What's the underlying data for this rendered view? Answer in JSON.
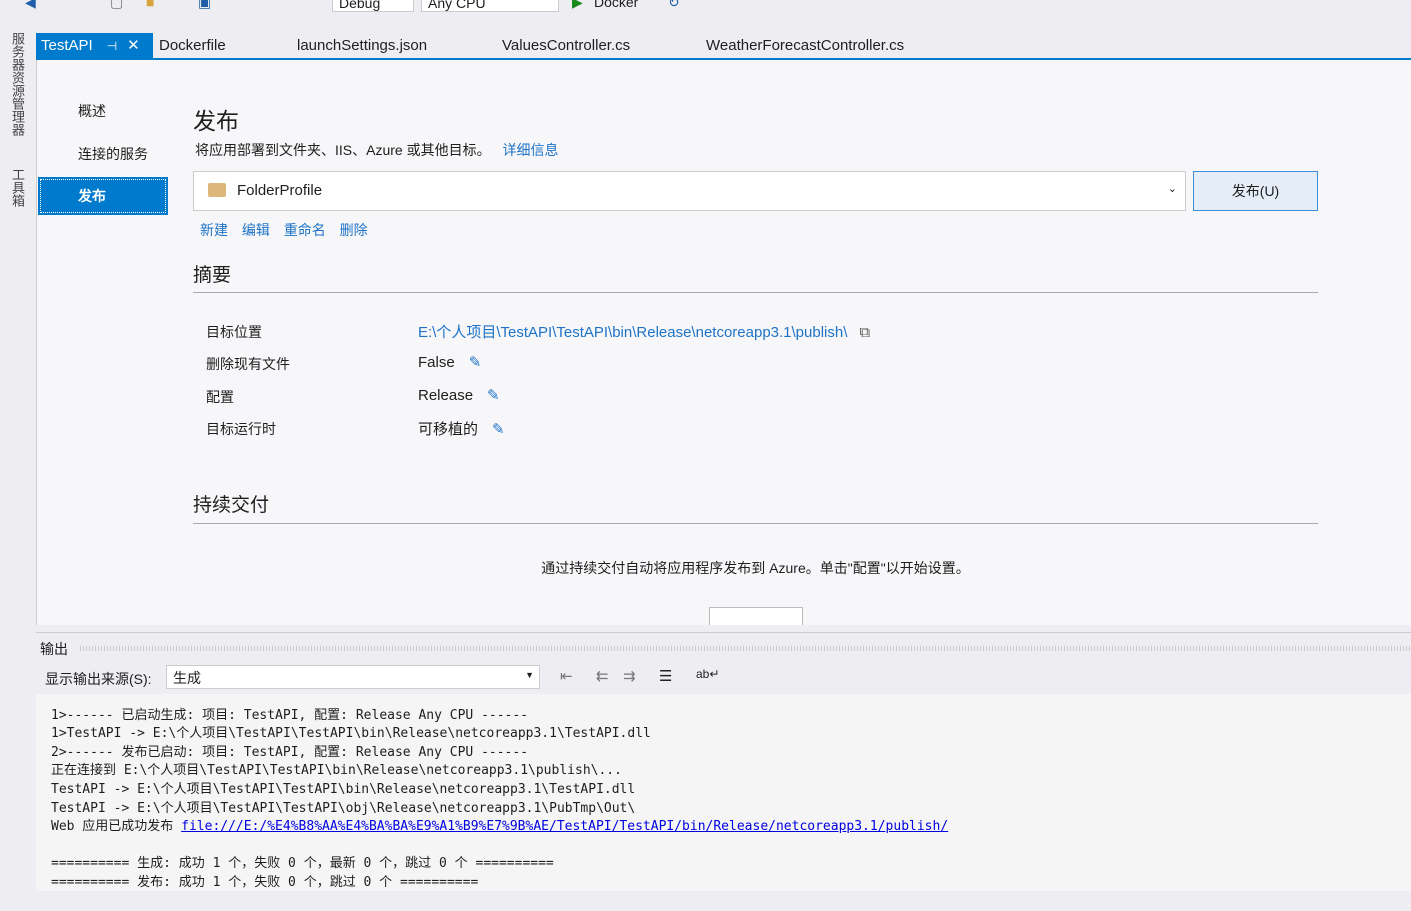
{
  "toolbar": {
    "config": "Debug",
    "platform": "Any CPU",
    "run_target": "Docker"
  },
  "left_strip": {
    "server_explorer": "服务器资源管理器",
    "toolbox": "工具箱"
  },
  "tabs": [
    {
      "label": "TestAPI"
    },
    {
      "label": "Dockerfile"
    },
    {
      "label": "launchSettings.json"
    },
    {
      "label": "ValuesController.cs"
    },
    {
      "label": "WeatherForecastController.cs"
    }
  ],
  "nav": [
    "概述",
    "连接的服务",
    "发布"
  ],
  "publish": {
    "title": "发布",
    "desc": "将应用部署到文件夹、IIS、Azure 或其他目标。",
    "more": "详细信息",
    "profile": "FolderProfile",
    "publish_btn": "发布(U)",
    "actions": [
      "新建",
      "编辑",
      "重命名",
      "删除"
    ]
  },
  "summary": {
    "title": "摘要",
    "rows": [
      {
        "label": "目标位置",
        "value": "E:\\个人项目\\TestAPI\\TestAPI\\bin\\Release\\netcoreapp3.1\\publish\\"
      },
      {
        "label": "删除现有文件",
        "value": "False"
      },
      {
        "label": "配置",
        "value": "Release"
      },
      {
        "label": "目标运行时",
        "value": "可移植的"
      }
    ]
  },
  "cd": {
    "title": "持续交付",
    "text": "通过持续交付自动将应用程序发布到 Azure。单击\"配置\"以开始设置。"
  },
  "output": {
    "title": "输出",
    "source_label": "显示输出来源(S):",
    "source": "生成",
    "lines": [
      "1>------ 已启动生成: 项目: TestAPI, 配置: Release Any CPU ------",
      "1>TestAPI -> E:\\个人项目\\TestAPI\\TestAPI\\bin\\Release\\netcoreapp3.1\\TestAPI.dll",
      "2>------ 发布已启动: 项目: TestAPI, 配置: Release Any CPU ------",
      "正在连接到 E:\\个人项目\\TestAPI\\TestAPI\\bin\\Release\\netcoreapp3.1\\publish\\...",
      "TestAPI -> E:\\个人项目\\TestAPI\\TestAPI\\bin\\Release\\netcoreapp3.1\\TestAPI.dll",
      "TestAPI -> E:\\个人项目\\TestAPI\\TestAPI\\obj\\Release\\netcoreapp3.1\\PubTmp\\Out\\"
    ],
    "web_prefix": "Web 应用已成功发布 ",
    "web_link": "file:///E:/%E4%B8%AA%E4%BA%BA%E9%A1%B9%E7%9B%AE/TestAPI/TestAPI/bin/Release/netcoreapp3.1/publish/",
    "summary_lines": [
      "========== 生成: 成功 1 个，失败 0 个，最新 0 个，跳过 0 个 ==========",
      "========== 发布: 成功 1 个，失败 0 个，跳过 0 个 =========="
    ]
  }
}
